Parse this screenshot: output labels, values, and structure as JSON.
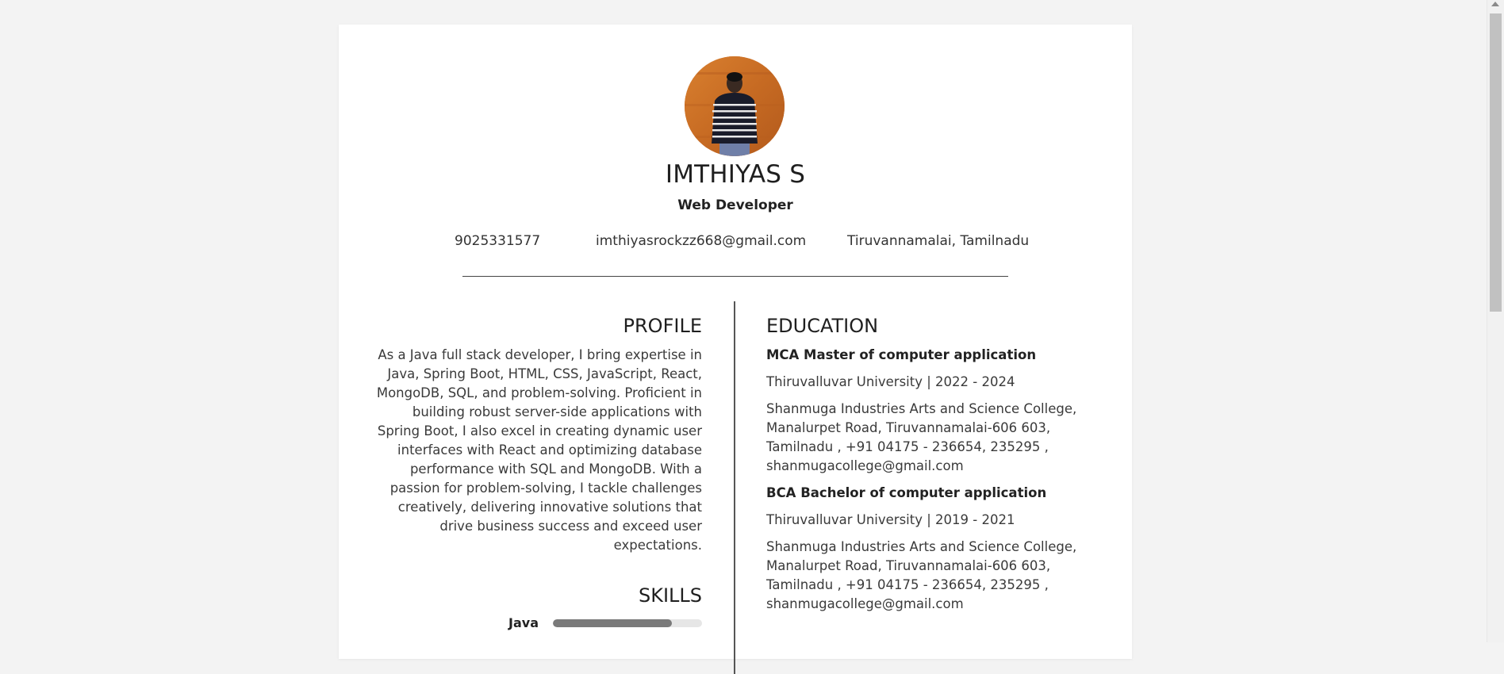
{
  "header": {
    "name": "IMTHIYAS S",
    "role": "Web Developer",
    "phone": "9025331577",
    "email": "imthiyasrockzz668@gmail.com",
    "location": "Tiruvannamalai, Tamilnadu"
  },
  "profile": {
    "title": "PROFILE",
    "text": "As a Java full stack developer, I bring expertise in Java, Spring Boot, HTML, CSS, JavaScript, React, MongoDB, SQL, and problem-solving. Proficient in building robust server-side applications with Spring Boot, I also excel in creating dynamic user interfaces with React and optimizing database performance with SQL and MongoDB. With a passion for problem-solving, I tackle challenges creatively, delivering innovative solutions that drive business success and exceed user expectations."
  },
  "skills": {
    "title": "SKILLS",
    "items": [
      {
        "name": "Java",
        "level": 0.8
      }
    ]
  },
  "education": {
    "title": "EDUCATION",
    "items": [
      {
        "degree": "MCA Master of computer application",
        "university": "Thiruvalluvar University | 2022 - 2024",
        "address": "Shanmuga Industries Arts and Science College, Manalurpet Road, Tiruvannamalai-606 603, Tamilnadu , +91 04175 - 236654, 235295 , shanmugacollege@gmail.com"
      },
      {
        "degree": "BCA Bachelor of computer application",
        "university": "Thiruvalluvar University | 2019 - 2021",
        "address": "Shanmuga Industries Arts and Science College, Manalurpet Road, Tiruvannamalai-606 603, Tamilnadu , +91 04175 - 236654, 235295 , shanmugacollege@gmail.com"
      }
    ]
  },
  "colors": {
    "background": "#f3f3f3",
    "card": "#ffffff",
    "text": "#222222",
    "skill_fill": "#7a7a7a",
    "skill_track": "#e6e6e6"
  },
  "icons": {
    "avatar": "profile-photo"
  }
}
